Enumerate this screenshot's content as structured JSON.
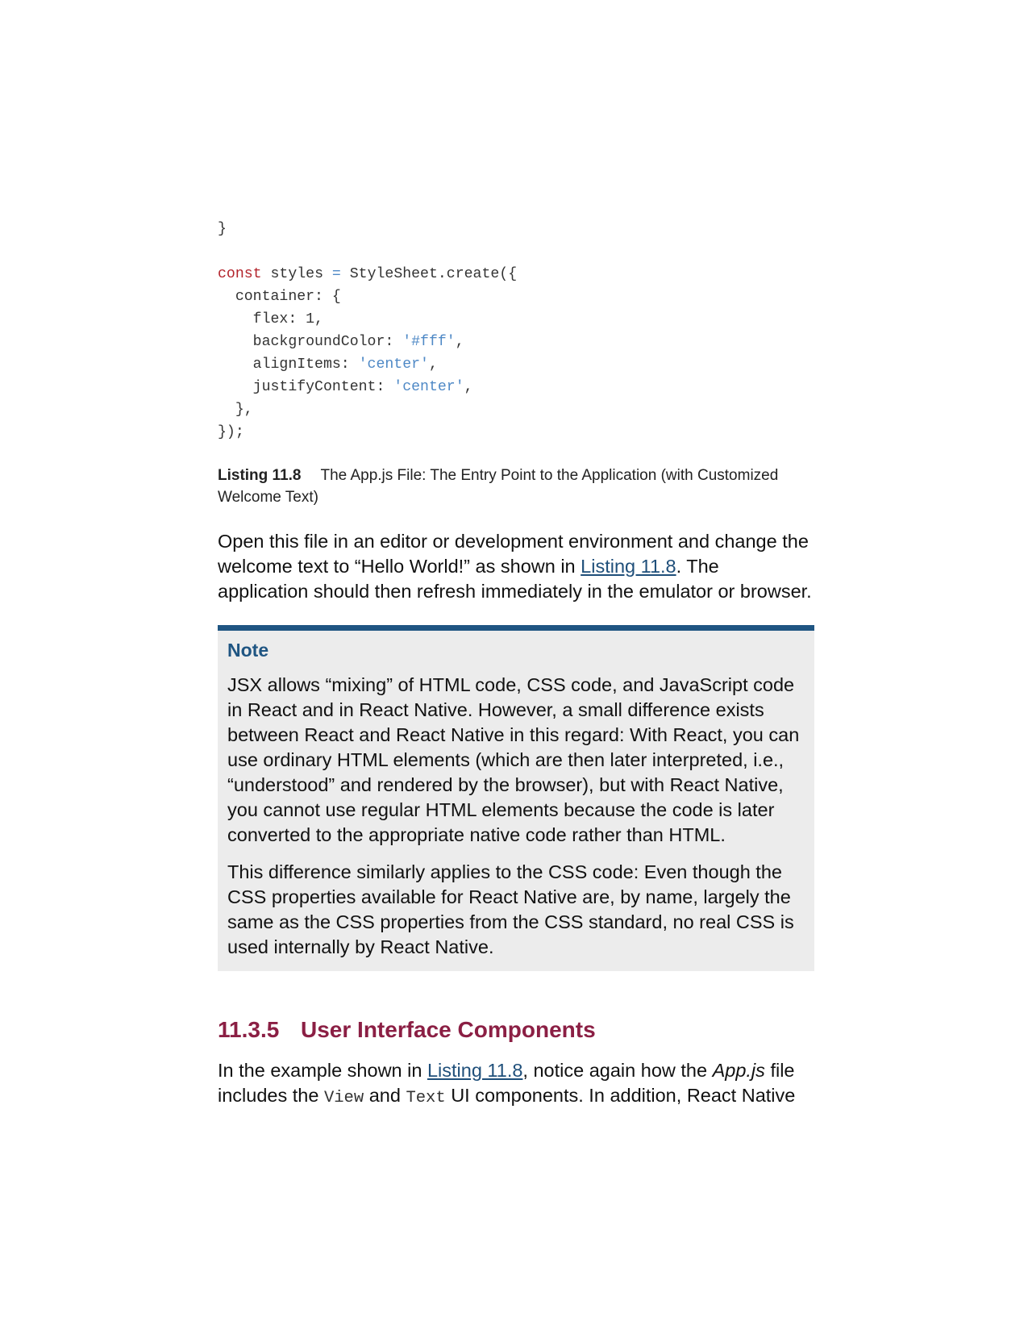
{
  "code": {
    "lines": [
      [
        {
          "t": "}",
          "c": ""
        }
      ],
      [
        {
          "t": "",
          "c": ""
        }
      ],
      [
        {
          "t": "const",
          "c": "kw"
        },
        {
          "t": " styles ",
          "c": ""
        },
        {
          "t": "=",
          "c": "op"
        },
        {
          "t": " StyleSheet.create({",
          "c": ""
        }
      ],
      [
        {
          "t": "  container: {",
          "c": ""
        }
      ],
      [
        {
          "t": "    flex: 1,",
          "c": ""
        }
      ],
      [
        {
          "t": "    backgroundColor: ",
          "c": ""
        },
        {
          "t": "'#fff'",
          "c": "str"
        },
        {
          "t": ",",
          "c": ""
        }
      ],
      [
        {
          "t": "    alignItems: ",
          "c": ""
        },
        {
          "t": "'center'",
          "c": "str"
        },
        {
          "t": ",",
          "c": ""
        }
      ],
      [
        {
          "t": "    justifyContent: ",
          "c": ""
        },
        {
          "t": "'center'",
          "c": "str"
        },
        {
          "t": ",",
          "c": ""
        }
      ],
      [
        {
          "t": "  },",
          "c": ""
        }
      ],
      [
        {
          "t": "});",
          "c": ""
        }
      ]
    ]
  },
  "caption": {
    "label": "Listing 11.8",
    "text": "The App.js File: The Entry Point to the Application (with Customized Welcome Text)"
  },
  "paragraph1": {
    "before": "Open this file in an editor or development environment and change the welcome text to “Hello World!” as shown in ",
    "link": "Listing 11.8",
    "after": ". The application should then refresh immediately in the emulator or browser."
  },
  "note": {
    "title": "Note",
    "paragraphs": [
      "JSX allows “mixing” of HTML code, CSS code, and JavaScript code in React and in React Native. However, a small difference exists between React and React Native in this regard: With React, you can use ordinary HTML elements (which are then later interpreted, i.e., “understood” and rendered by the browser), but with React Native, you cannot use regular HTML elements because the code is later converted to the appropriate native code rather than HTML.",
      "This difference similarly applies to the CSS code: Even though the CSS properties available for React Native are, by name, largely the same as the CSS properties from the CSS standard, no real CSS is used internally by React Native."
    ]
  },
  "section": {
    "number": "11.3.5",
    "title": "User Interface Components"
  },
  "paragraph2": {
    "part1": "In the example shown in ",
    "link": "Listing 11.8",
    "part2": ", notice again how the ",
    "italic": "App.js",
    "part3": " file includes the ",
    "code1": "View",
    "part4": " and ",
    "code2": "Text",
    "part5": " UI components. In addition, React Native"
  },
  "colors": {
    "keyword": "#b3242c",
    "string": "#4f89c6",
    "note_accent": "#1f5582",
    "note_background": "#ececec",
    "section_heading": "#8b1f44",
    "link": "#1f4f7a"
  }
}
